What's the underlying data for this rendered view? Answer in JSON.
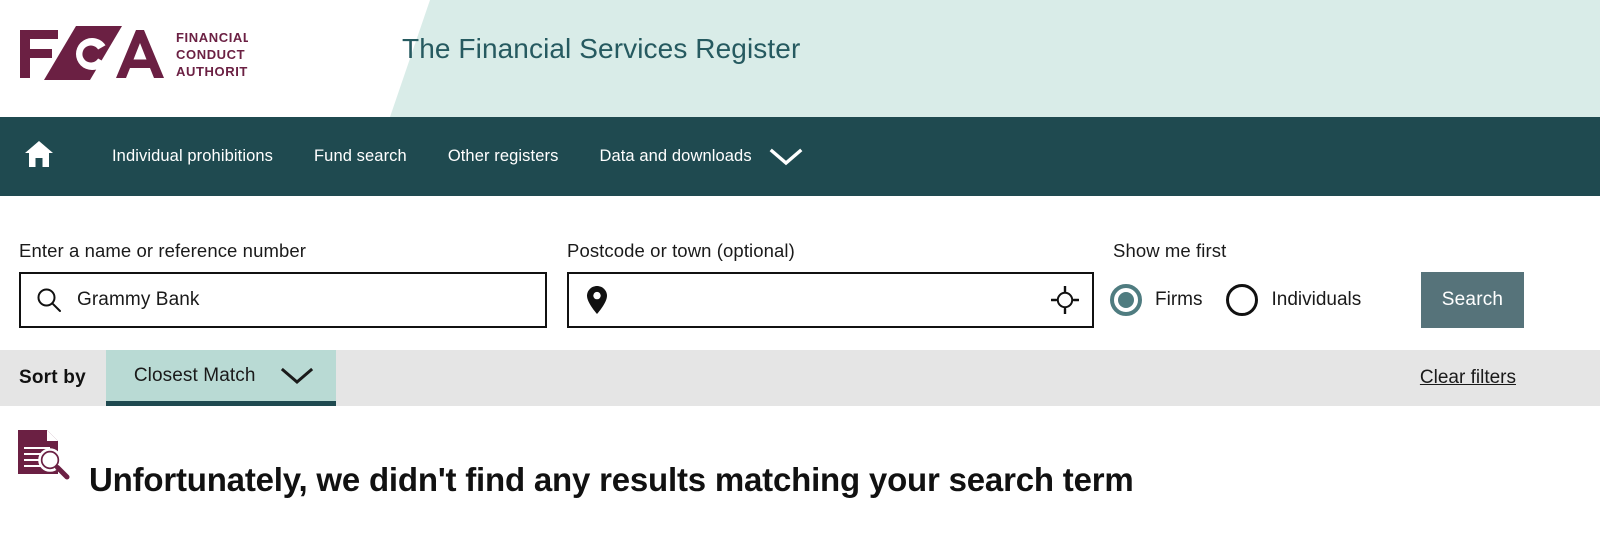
{
  "header": {
    "logo": {
      "mark_text": "FCA",
      "line1": "FINANCIAL",
      "line2": "CONDUCT",
      "line3": "AUTHORITY",
      "icon_name": "fca-logo",
      "color": "#6b2043"
    },
    "register_title": "The Financial Services Register",
    "title_color": "#265a60",
    "band_color": "#d9ece8"
  },
  "nav": {
    "background": "#1f4a50",
    "home_icon": "home-icon",
    "items": [
      {
        "label": "Individual prohibitions"
      },
      {
        "label": "Fund search"
      },
      {
        "label": "Other registers"
      },
      {
        "label": "Data and downloads",
        "caret": "chevron-down-icon"
      }
    ]
  },
  "search": {
    "name_field": {
      "label": "Enter a name or reference number",
      "value": "Grammy Bank",
      "placeholder": "Enter a name or reference number",
      "icon": "search-icon"
    },
    "postcode_field": {
      "label": "Postcode or town (optional)",
      "value": "",
      "placeholder": "",
      "left_icon": "map-pin-icon",
      "right_icon": "crosshair-locate-icon"
    },
    "show_me_first": {
      "label": "Show me first",
      "options": [
        {
          "label": "Firms",
          "selected": true
        },
        {
          "label": "Individuals",
          "selected": false
        }
      ],
      "selected_color": "#4f7c80"
    },
    "search_button": {
      "label": "Search",
      "background": "#56737a"
    }
  },
  "sort_bar": {
    "background": "#e5e5e5",
    "label": "Sort by",
    "selected_option": "Closest Match",
    "caret_icon": "chevron-down-icon",
    "tab_background": "#b9dad4",
    "tab_underline": "#1f4a50",
    "clear_filters": "Clear filters"
  },
  "results": {
    "icon": "document-search-icon",
    "icon_color": "#6b2043",
    "message": "Unfortunately, we didn't find any results matching your search term"
  }
}
